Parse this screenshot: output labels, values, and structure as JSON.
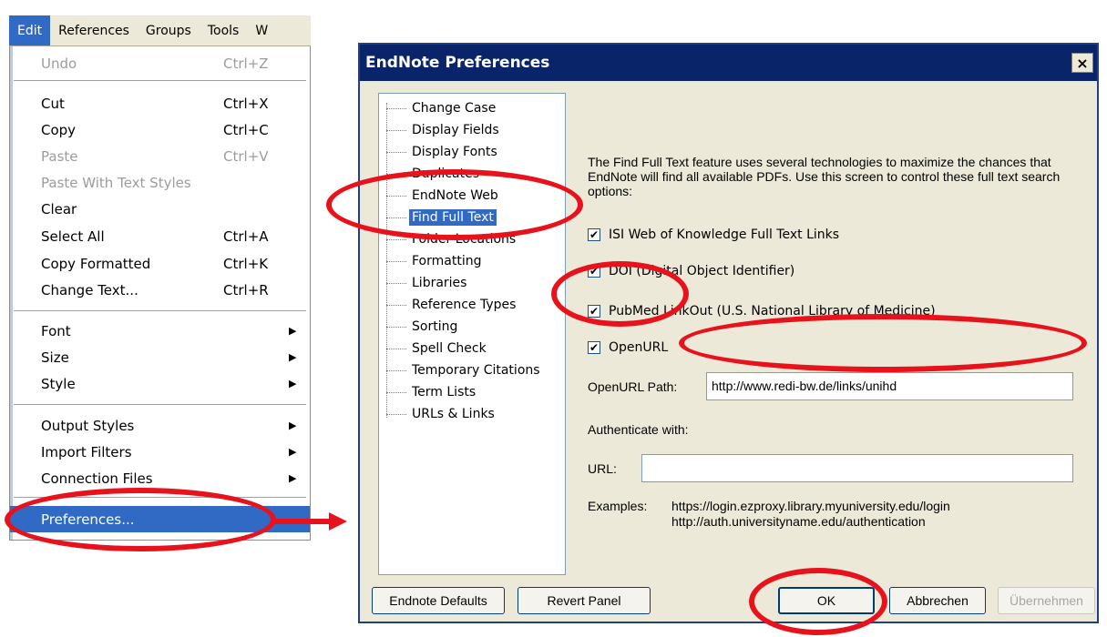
{
  "menubar": {
    "items": [
      "Edit",
      "References",
      "Groups",
      "Tools",
      "W"
    ],
    "active": "Edit"
  },
  "edit_menu": {
    "undo": {
      "label": "Undo",
      "shortcut": "Ctrl+Z"
    },
    "cut": {
      "label": "Cut",
      "shortcut": "Ctrl+X"
    },
    "copy": {
      "label": "Copy",
      "shortcut": "Ctrl+C"
    },
    "paste": {
      "label": "Paste",
      "shortcut": "Ctrl+V"
    },
    "paste_with_text_styles": {
      "label": "Paste With Text Styles"
    },
    "clear": {
      "label": "Clear"
    },
    "select_all": {
      "label": "Select All",
      "shortcut": "Ctrl+A"
    },
    "copy_formatted": {
      "label": "Copy Formatted",
      "shortcut": "Ctrl+K"
    },
    "change_text": {
      "label": "Change Text...",
      "shortcut": "Ctrl+R"
    },
    "font": {
      "label": "Font"
    },
    "size": {
      "label": "Size"
    },
    "style": {
      "label": "Style"
    },
    "output_styles": {
      "label": "Output Styles"
    },
    "import_filters": {
      "label": "Import Filters"
    },
    "connection_files": {
      "label": "Connection Files"
    },
    "preferences": {
      "label": "Preferences..."
    }
  },
  "dialog": {
    "title": "EndNote Preferences",
    "close_glyph": "×",
    "tree": [
      "Change Case",
      "Display Fields",
      "Display Fonts",
      "Duplicates",
      "EndNote Web",
      "Find Full Text",
      "Folder Locations",
      "Formatting",
      "Libraries",
      "Reference Types",
      "Sorting",
      "Spell Check",
      "Temporary Citations",
      "Term Lists",
      "URLs & Links"
    ],
    "selected_tree_item": "Find Full Text",
    "description": "The Find Full Text feature uses several technologies to maximize the chances that EndNote will find all available PDFs. Use this screen to control these full text search options:",
    "options": {
      "isi": {
        "label": "ISI Web of Knowledge Full Text Links",
        "checked": true
      },
      "doi": {
        "label": "DOI (Digital Object Identifier)",
        "checked": true
      },
      "pubmed": {
        "label": "PubMed LinkOut (U.S. National Library of Medicine)",
        "checked": true
      },
      "openurl": {
        "label": "OpenURL",
        "checked": true
      }
    },
    "check_glyph": "✔",
    "openurl_path": {
      "label": "OpenURL Path:",
      "value": "http://www.redi-bw.de/links/unihd"
    },
    "authenticate_label": "Authenticate with:",
    "url_field": {
      "label": "URL:",
      "value": ""
    },
    "examples": {
      "label": "Examples:",
      "line1": "https://login.ezproxy.library.myuniversity.edu/login",
      "line2": "http://auth.universityname.edu/authentication"
    },
    "buttons": {
      "endnote_defaults": "Endnote Defaults",
      "revert_panel": "Revert Panel",
      "ok": "OK",
      "abbrechen": "Abbrechen",
      "uebernehmen": "Übernehmen"
    }
  },
  "colors": {
    "annotation": "#e8121c",
    "selection": "#316ac5",
    "titlebar": "#0a246a"
  }
}
